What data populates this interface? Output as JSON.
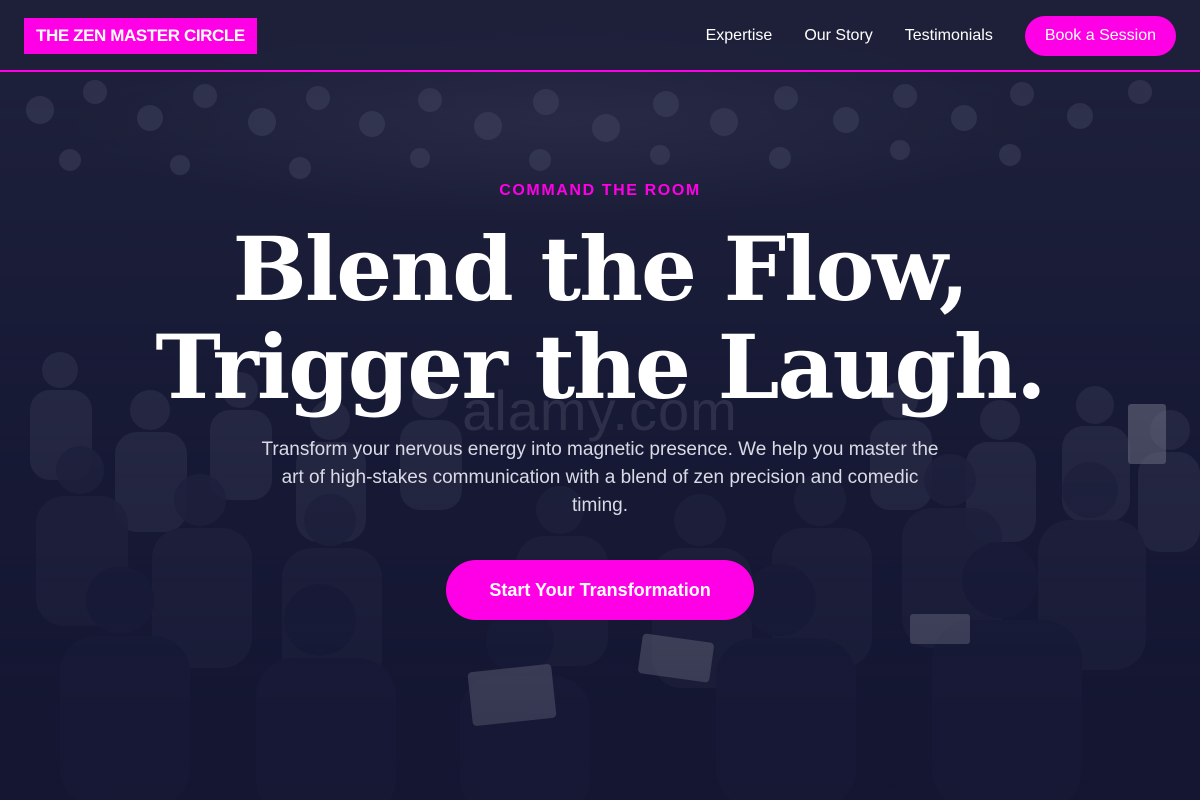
{
  "header": {
    "logo_text": "THE ZEN MASTER CIRCLE",
    "nav": [
      {
        "label": "Expertise"
      },
      {
        "label": "Our Story"
      },
      {
        "label": "Testimonials"
      }
    ],
    "cta_label": "Book a Session"
  },
  "hero": {
    "eyebrow": "COMMAND THE ROOM",
    "headline_line1": "Blend the Flow,",
    "headline_line2": "Trigger the Laugh.",
    "subtext": "Transform your nervous energy into magnetic presence. We help you master the art of high-stakes communication with a blend of zen precision and comedic timing.",
    "cta_label": "Start Your Transformation",
    "watermark": "alamy.com",
    "background_image": "conference-audience-photo"
  },
  "colors": {
    "accent": "#ff00e6",
    "header_bg": "#1e213a",
    "hero_overlay": "#161834",
    "text": "#ffffff"
  }
}
